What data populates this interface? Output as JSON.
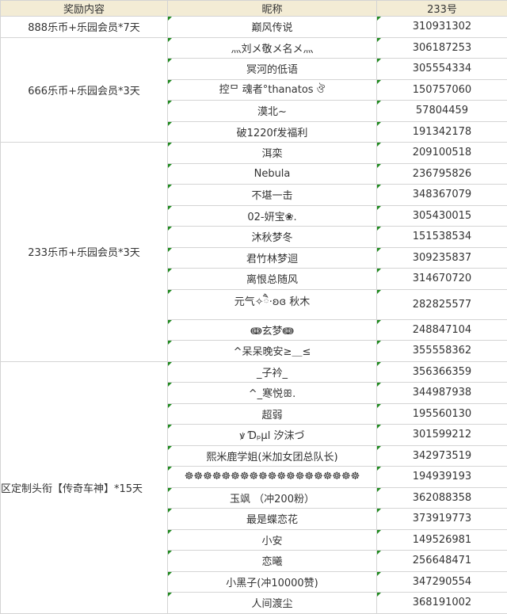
{
  "table": {
    "headers": [
      "奖励内容",
      "昵称",
      "233号"
    ],
    "groups": [
      {
        "reward": "888乐币+乐园会员*7天",
        "rows": [
          {
            "name": "巅风传说",
            "id": "310931302"
          }
        ]
      },
      {
        "reward": "666乐币+乐园会员*3天",
        "rows": [
          {
            "name": "灬刘メ敬メ名メ灬",
            "id": "306187253"
          },
          {
            "name": "冥河的低语",
            "id": "305554334"
          },
          {
            "name": "控ᄆ 魂者°thanatos ঔ",
            "id": "150757060"
          },
          {
            "name": "漠北~",
            "id": "57804459"
          },
          {
            "name": "破1220f发福利",
            "id": "191342178"
          }
        ]
      },
      {
        "reward": "233乐币+乐园会员*3天",
        "rows": [
          {
            "name": "洱栾",
            "id": "209100518"
          },
          {
            "name": "Nebula",
            "id": "236795826"
          },
          {
            "name": "不堪一击",
            "id": "348367079"
          },
          {
            "name": "02-妍宝❀.",
            "id": "305430015"
          },
          {
            "name": "沐秋梦冬",
            "id": "151538534"
          },
          {
            "name": "君竹林梦迴",
            "id": "309235837"
          },
          {
            "name": "离恨总随风",
            "id": "314670720"
          },
          {
            "name": "元气✧ཻ·ʚɞ 秋木",
            "id": "282825577"
          },
          {
            "name": "ↈ玄梦ↈ",
            "id": "248847104"
          },
          {
            "name": "^呆呆晚安≥＿≤",
            "id": "355558362"
          }
        ]
      },
      {
        "reward": "区定制头衔【传奇车神】*15天",
        "rows": [
          {
            "name": "_子衿_",
            "id": "356366359"
          },
          {
            "name": "^_寒悦ꕥ.",
            "id": "344987938"
          },
          {
            "name": "超弱",
            "id": "195560130"
          },
          {
            "name": "ꝟ Ɗₚμl 汐沫づ",
            "id": "301599212"
          },
          {
            "name": "熙米鹿学姐(米加女团总队长)",
            "id": "342973519"
          },
          {
            "name": "☸☸☸☸☸☸☸☸☸☸☸☸☸☸☸☸☸☸☸",
            "id": "194939193"
          },
          {
            "name": "玉飒 （冲200粉）",
            "id": "362088358"
          },
          {
            "name": "最是蝶恋花",
            "id": "373919773"
          },
          {
            "name": "小安",
            "id": "149526981"
          },
          {
            "name": "恋曦",
            "id": "256648471"
          },
          {
            "name": "小黑子(冲10000赞)",
            "id": "347290554"
          },
          {
            "name": "人间渡尘",
            "id": "368191002"
          }
        ]
      }
    ]
  }
}
